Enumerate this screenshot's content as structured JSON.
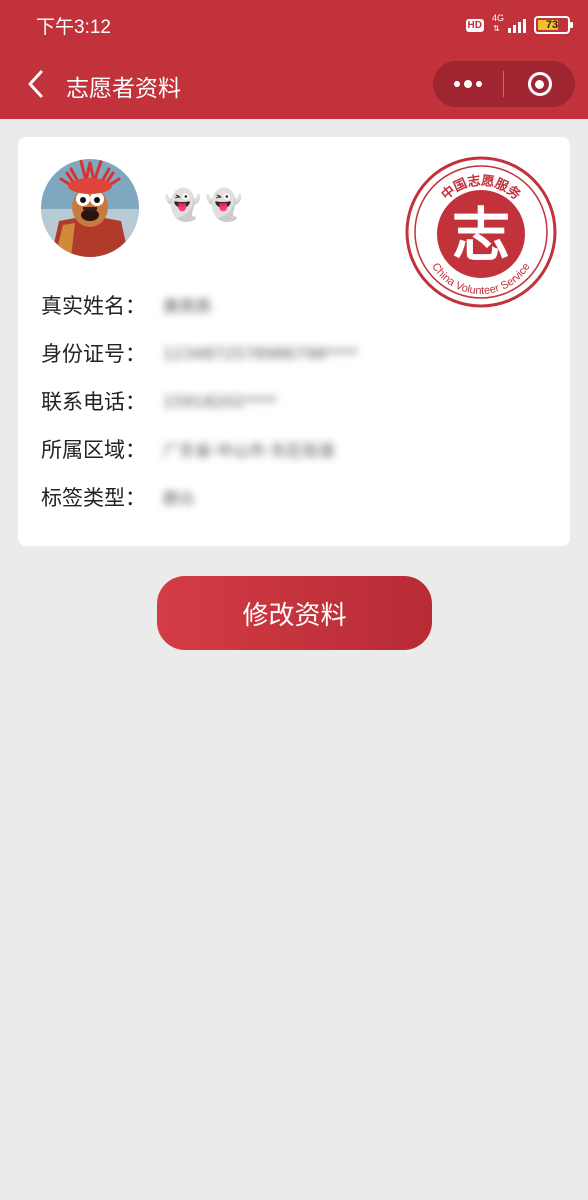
{
  "status_bar": {
    "time": "下午3:12",
    "hd": "HD",
    "network": "4G",
    "network_arrows": "⇅",
    "battery": "73",
    "battery_level_percent": 73,
    "battery_color": "#f3c12c"
  },
  "nav": {
    "title": "志愿者资料",
    "back_icon": "chevron-left-icon",
    "more_icon": "more-dots-icon",
    "close_icon": "target-circle-icon"
  },
  "profile": {
    "nickname_emoji": [
      "👻",
      "👻"
    ],
    "logo_text_top": "中国志愿服务",
    "logo_text_bottom": "China Volunteer Service",
    "logo_glyph": "志",
    "fields": [
      {
        "label": "真实姓名：",
        "value": "黄燕燕"
      },
      {
        "label": "身份证号：",
        "value": "1234872578986798****"
      },
      {
        "label": "联系电话：",
        "value": "15918202****"
      },
      {
        "label": "所属区域：",
        "value": "广东省-中山市-东区街道"
      },
      {
        "label": "标签类型：",
        "value": "群众"
      }
    ]
  },
  "actions": {
    "edit_label": "修改资料"
  },
  "colors": {
    "brand_red": "#c1323a",
    "background": "#ebebeb"
  }
}
